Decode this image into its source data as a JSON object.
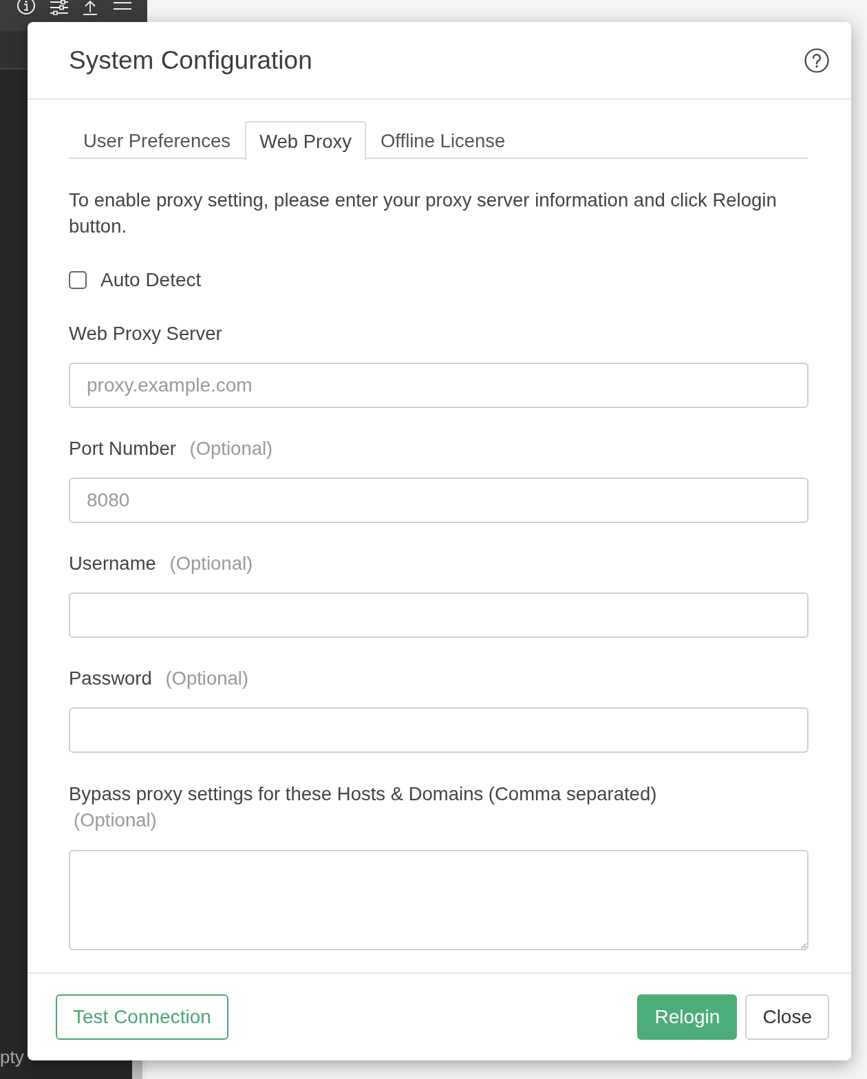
{
  "background": {
    "side_text": "pty"
  },
  "dialog": {
    "title": "System Configuration",
    "tabs": [
      {
        "label": "User Preferences",
        "selected": false
      },
      {
        "label": "Web Proxy",
        "selected": true
      },
      {
        "label": "Offline License",
        "selected": false
      }
    ],
    "description": "To enable proxy setting, please enter your proxy server information and click Relogin button.",
    "auto_detect": {
      "label": "Auto Detect",
      "checked": false
    },
    "fields": [
      {
        "kind": "input",
        "label": "Web Proxy Server",
        "placeholder": "proxy.example.com"
      },
      {
        "kind": "input",
        "label": "Port Number",
        "optional": "(Optional)",
        "placeholder": "8080"
      },
      {
        "kind": "input",
        "label": "Username",
        "optional": "(Optional)"
      },
      {
        "kind": "input",
        "label": "Password",
        "optional": "(Optional)"
      },
      {
        "kind": "textarea",
        "label": "Bypass proxy settings for these Hosts & Domains (Comma separated)",
        "optional": "(Optional)"
      }
    ],
    "buttons": [
      {
        "label": "Test Connection",
        "kind": "outline"
      },
      {
        "label": "Relogin",
        "kind": "primary"
      },
      {
        "label": "Close",
        "kind": "default"
      }
    ]
  }
}
